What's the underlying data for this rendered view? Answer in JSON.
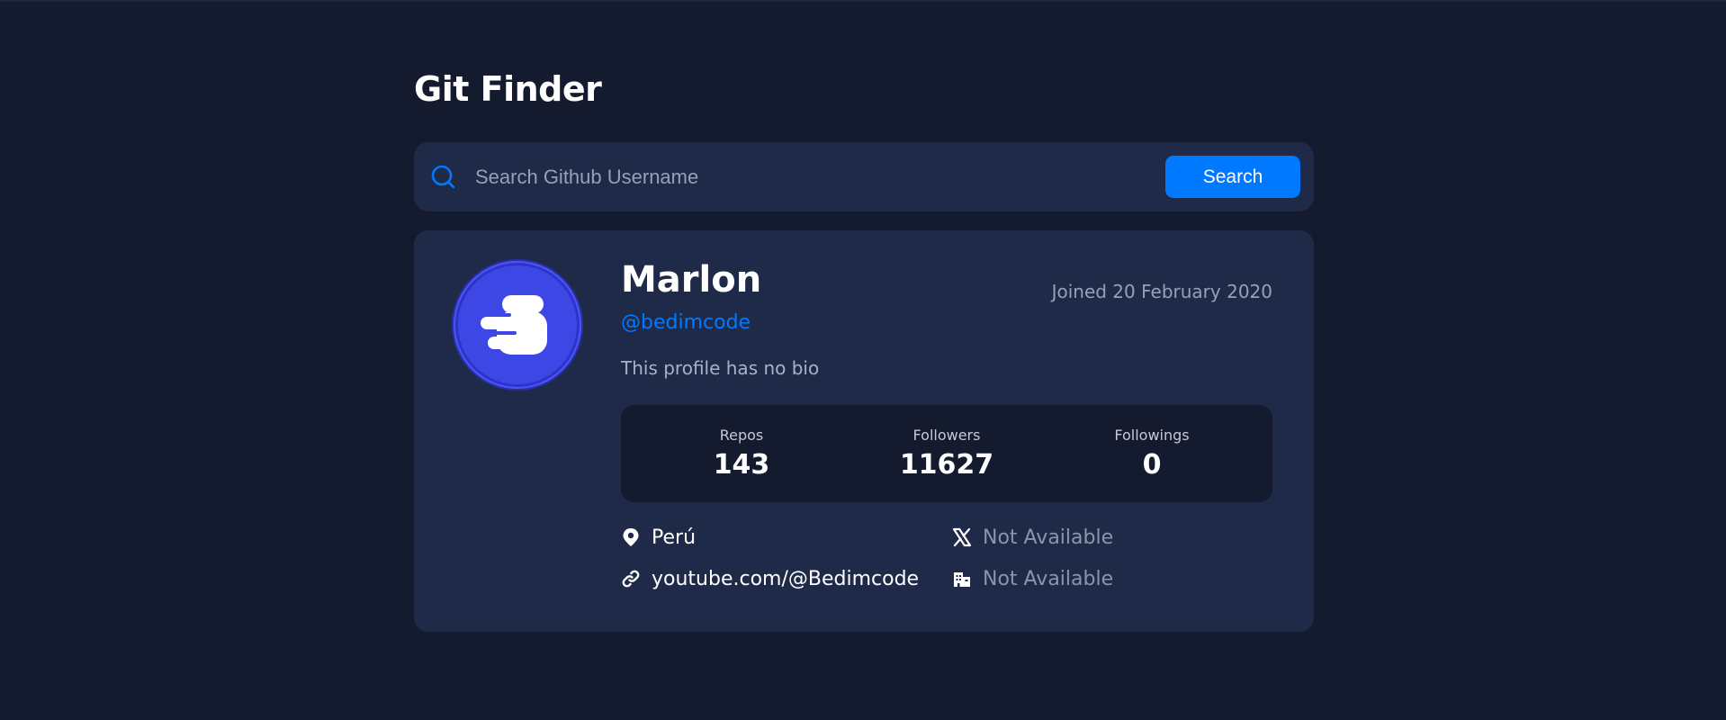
{
  "app": {
    "title": "Git Finder"
  },
  "search": {
    "placeholder": "Search Github Username",
    "value": "",
    "button_label": "Search"
  },
  "profile": {
    "name": "Marlon",
    "login": "@bedimcode",
    "joined": "Joined 20 February 2020",
    "bio": "This profile has no bio",
    "stats": [
      {
        "label": "Repos",
        "value": "143"
      },
      {
        "label": "Followers",
        "value": "11627"
      },
      {
        "label": "Followings",
        "value": "0"
      }
    ],
    "links": {
      "location": "Perú",
      "twitter": "Not Available",
      "website": "youtube.com/@Bedimcode",
      "company": "Not Available"
    },
    "icons": {
      "location": "location-pin-icon",
      "twitter": "x-logo-icon",
      "website": "link-icon",
      "company": "building-icon"
    }
  },
  "colors": {
    "background": "#141b2e",
    "card": "#1f2a48",
    "accent": "#0079ff",
    "avatar": "#3d47e6"
  }
}
